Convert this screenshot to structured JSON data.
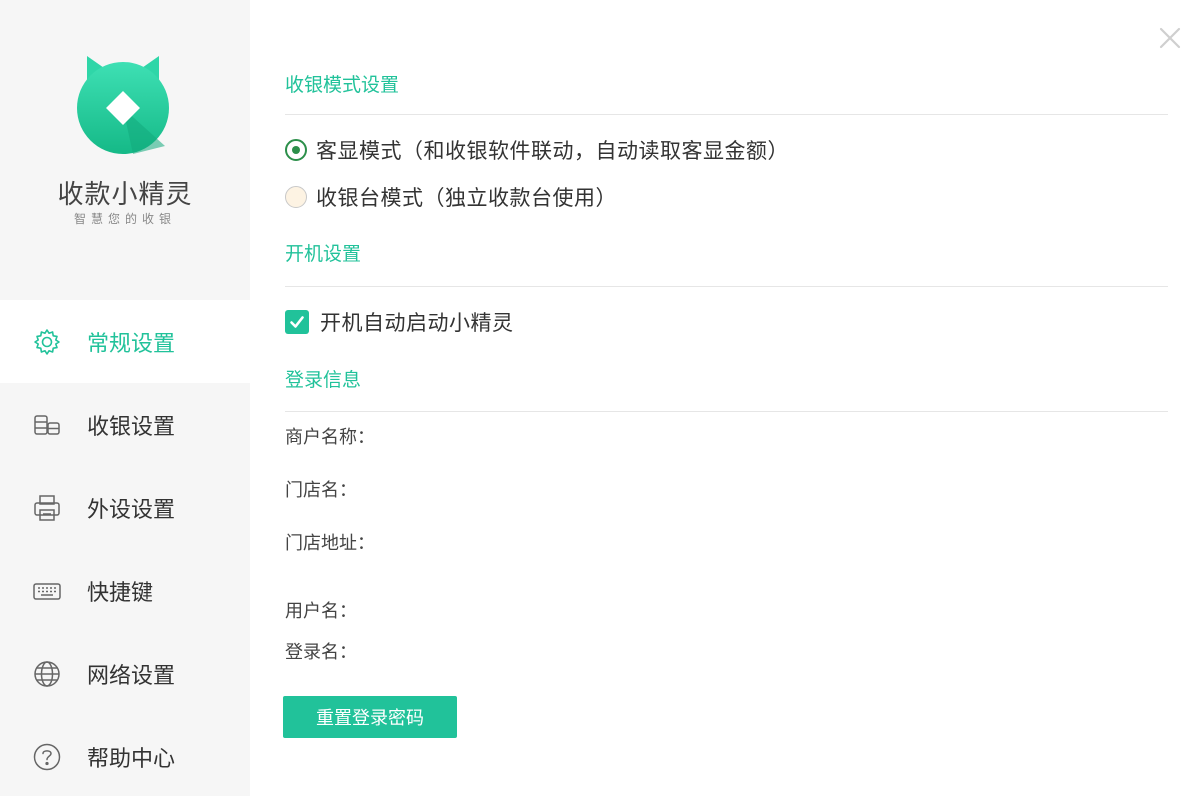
{
  "app": {
    "name": "收款小精灵",
    "tagline": "智慧您的收银",
    "brand_color": "#21c29a"
  },
  "sidebar": {
    "items": [
      {
        "label": "常规设置",
        "icon": "gear-icon",
        "active": true
      },
      {
        "label": "收银设置",
        "icon": "coins-icon",
        "active": false
      },
      {
        "label": "外设设置",
        "icon": "printer-icon",
        "active": false
      },
      {
        "label": "快捷键",
        "icon": "keyboard-icon",
        "active": false
      },
      {
        "label": "网络设置",
        "icon": "globe-icon",
        "active": false
      },
      {
        "label": "帮助中心",
        "icon": "help-icon",
        "active": false
      }
    ]
  },
  "window": {
    "close_icon": "close-icon"
  },
  "cashier_mode": {
    "title": "收银模式设置",
    "options": [
      {
        "label": "客显模式（和收银软件联动，自动读取客显金额）",
        "selected": true
      },
      {
        "label": "收银台模式（独立收款台使用）",
        "selected": false
      }
    ]
  },
  "startup": {
    "title": "开机设置",
    "autostart_label": "开机自动启动小精灵",
    "autostart_checked": true
  },
  "login_info": {
    "title": "登录信息",
    "fields": [
      {
        "label": "商户名称：",
        "value": ""
      },
      {
        "label": "门店名：",
        "value": ""
      },
      {
        "label": "门店地址：",
        "value": ""
      },
      {
        "label": "用户名：",
        "value": ""
      },
      {
        "label": "登录名：",
        "value": ""
      }
    ],
    "reset_button": "重置登录密码"
  }
}
